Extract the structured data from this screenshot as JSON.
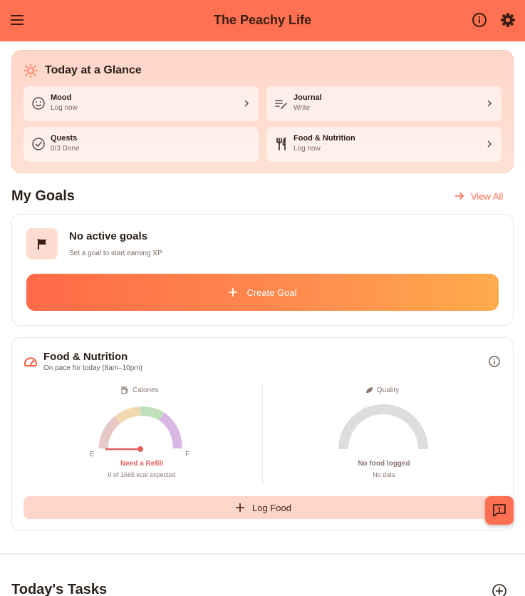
{
  "app": {
    "title": "The Peachy Life"
  },
  "glance": {
    "title": "Today at a Glance",
    "tiles": [
      {
        "label": "Mood",
        "sub": "Log now",
        "icon": "smile-icon"
      },
      {
        "label": "Journal",
        "sub": "Write",
        "icon": "edit-note-icon"
      },
      {
        "label": "Quests",
        "sub": "0/3 Done",
        "icon": "check-circle-icon"
      },
      {
        "label": "Food & Nutrition",
        "sub": "Log now",
        "icon": "utensils-icon"
      }
    ]
  },
  "goals": {
    "title": "My Goals",
    "view_all": "View All",
    "empty_title": "No active goals",
    "empty_sub": "Set a goal to start earning XP",
    "create_label": "Create Goal"
  },
  "nutrition": {
    "title": "Food & Nutrition",
    "subtitle": "On pace for today (8am–10pm)",
    "calories": {
      "label": "Calories",
      "empty_mark": "E",
      "full_mark": "F",
      "status": "Need a Refill",
      "detail": "0 of 1665 kcal expected",
      "fraction": 0
    },
    "quality": {
      "label": "Quality",
      "status": "No food logged",
      "detail": "No data"
    },
    "log_label": "Log Food"
  },
  "tasks": {
    "title": "Today's Tasks"
  },
  "colors": {
    "brand": "#ff7152",
    "accent": "#ff6a4a",
    "panel": "#ffd6c9",
    "refill_red": "#e06060"
  }
}
